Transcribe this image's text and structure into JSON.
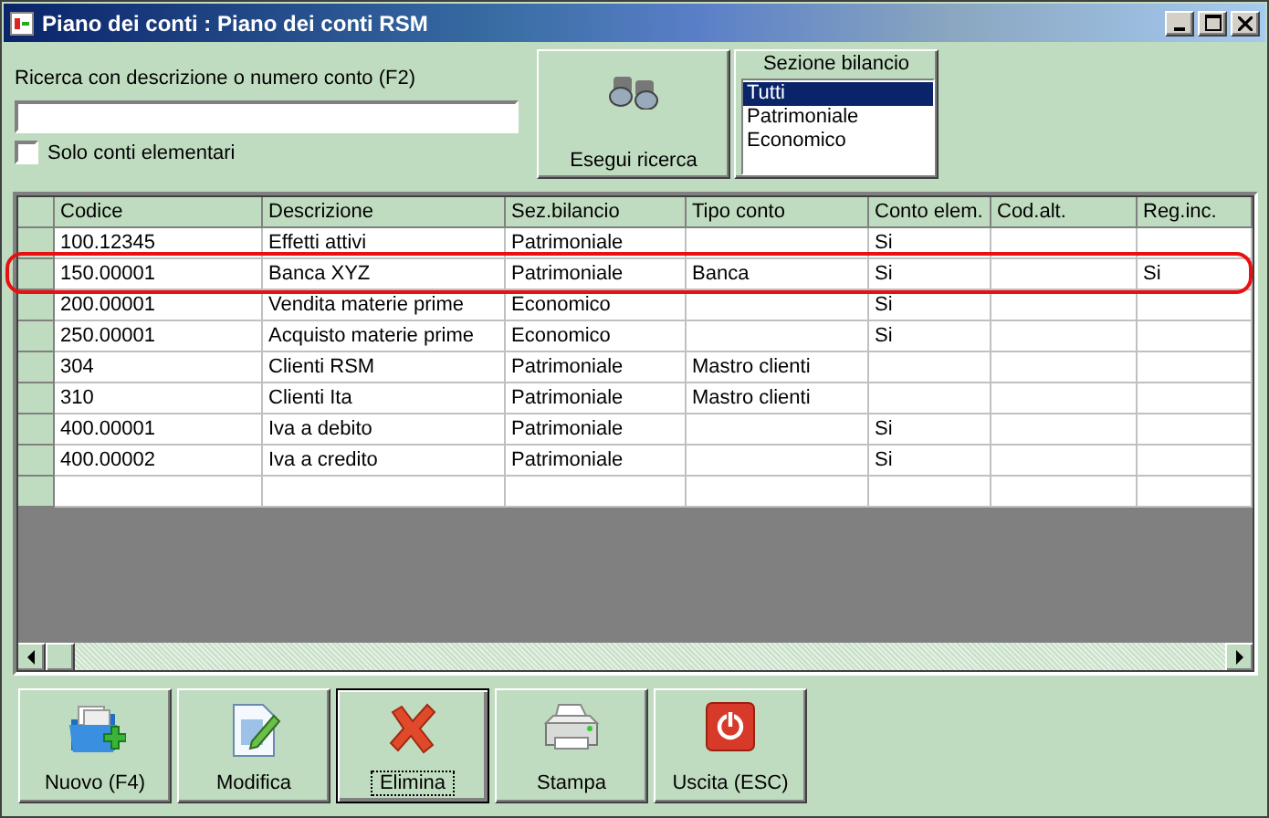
{
  "window": {
    "title": "Piano dei conti : Piano dei conti RSM"
  },
  "search": {
    "label": "Ricerca con descrizione o numero conto (F2)",
    "only_elementary": {
      "label": "Solo conti elementari",
      "checked": false
    },
    "button": "Esegui ricerca"
  },
  "section_filter": {
    "title": "Sezione bilancio",
    "options": [
      {
        "label": "Tutti",
        "selected": true
      },
      {
        "label": "Patrimoniale",
        "selected": false
      },
      {
        "label": "Economico",
        "selected": false
      }
    ]
  },
  "table": {
    "columns": [
      "Codice",
      "Descrizione",
      "Sez.bilancio",
      "Tipo conto",
      "Conto elem.",
      "Cod.alt.",
      "Reg.inc."
    ],
    "rows": [
      {
        "cells": [
          "100.12345",
          "Effetti attivi",
          "Patrimoniale",
          "",
          "Si",
          "",
          ""
        ],
        "highlighted": false
      },
      {
        "cells": [
          "150.00001",
          "Banca XYZ",
          "Patrimoniale",
          "Banca",
          "Si",
          "",
          "Si"
        ],
        "highlighted": true
      },
      {
        "cells": [
          "200.00001",
          "Vendita materie prime",
          "Economico",
          "",
          "Si",
          "",
          ""
        ],
        "highlighted": false
      },
      {
        "cells": [
          "250.00001",
          "Acquisto materie prime",
          "Economico",
          "",
          "Si",
          "",
          ""
        ],
        "highlighted": false
      },
      {
        "cells": [
          "304",
          "Clienti RSM",
          "Patrimoniale",
          "Mastro clienti",
          "",
          "",
          ""
        ],
        "highlighted": false
      },
      {
        "cells": [
          "310",
          "Clienti Ita",
          "Patrimoniale",
          "Mastro clienti",
          "",
          "",
          ""
        ],
        "highlighted": false
      },
      {
        "cells": [
          "400.00001",
          "Iva a debito",
          "Patrimoniale",
          "",
          "Si",
          "",
          ""
        ],
        "highlighted": false
      },
      {
        "cells": [
          "400.00002",
          "Iva a credito",
          "Patrimoniale",
          "",
          "Si",
          "",
          ""
        ],
        "highlighted": false
      }
    ]
  },
  "toolbar": [
    {
      "label": "Nuovo (F4)",
      "kind": "new",
      "focused": false
    },
    {
      "label": "Modifica",
      "kind": "edit",
      "focused": false
    },
    {
      "label": "Elimina",
      "kind": "delete",
      "focused": true
    },
    {
      "label": "Stampa",
      "kind": "print",
      "focused": false
    },
    {
      "label": "Uscita (ESC)",
      "kind": "exit",
      "focused": false
    }
  ]
}
